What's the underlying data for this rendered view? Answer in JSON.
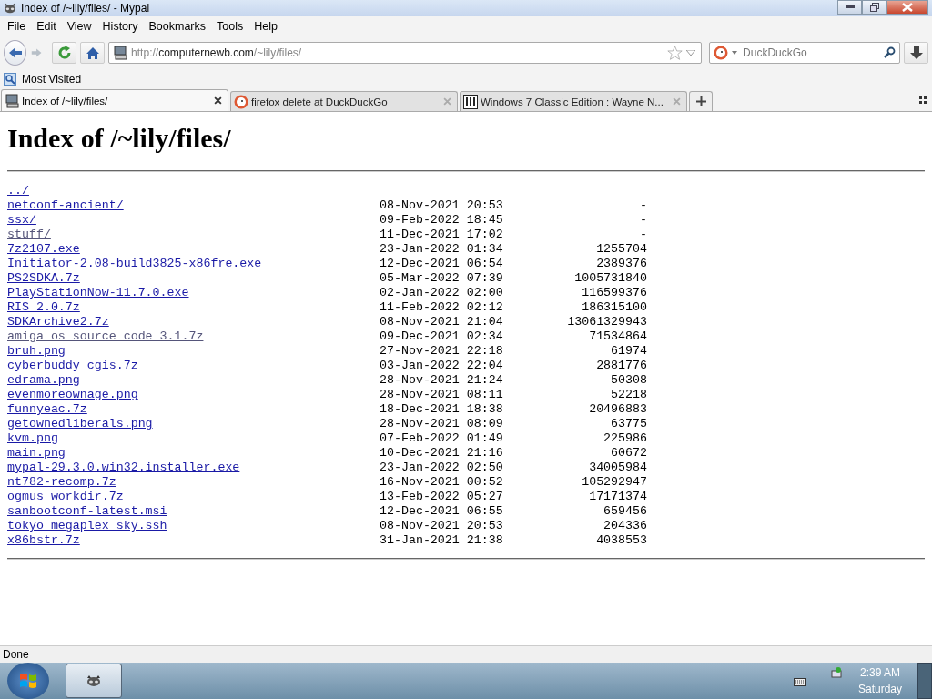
{
  "window": {
    "title": "Index of /~lily/files/ - Mypal"
  },
  "menu": [
    "File",
    "Edit",
    "View",
    "History",
    "Bookmarks",
    "Tools",
    "Help"
  ],
  "address_bar": {
    "scheme": "http://",
    "host": "computernewb.com",
    "path": "/~lily/files/"
  },
  "search": {
    "placeholder": "DuckDuckGo"
  },
  "bookmarks": [
    "Most Visited"
  ],
  "tabs": [
    {
      "label": "Index of /~lily/files/",
      "selected": true,
      "kind": "page"
    },
    {
      "label": "firefox delete at DuckDuckGo",
      "selected": false,
      "kind": "duck"
    },
    {
      "label": "Windows 7 Classic Edition : Wayne N...",
      "selected": false,
      "kind": "archive"
    }
  ],
  "page": {
    "heading": "Index of /~lily/files/",
    "rows": [
      {
        "name": "../",
        "date": "",
        "size": "",
        "visited": false
      },
      {
        "name": "netconf-ancient/",
        "date": "08-Nov-2021 20:53",
        "size": "-",
        "visited": false
      },
      {
        "name": "ssx/",
        "date": "09-Feb-2022 18:45",
        "size": "-",
        "visited": false
      },
      {
        "name": "stuff/",
        "date": "11-Dec-2021 17:02",
        "size": "-",
        "visited": true
      },
      {
        "name": "7z2107.exe",
        "date": "23-Jan-2022 01:34",
        "size": "1255704",
        "visited": false
      },
      {
        "name": "Initiator-2.08-build3825-x86fre.exe",
        "date": "12-Dec-2021 06:54",
        "size": "2389376",
        "visited": false
      },
      {
        "name": "PS2SDKA.7z",
        "date": "05-Mar-2022 07:39",
        "size": "1005731840",
        "visited": false
      },
      {
        "name": "PlayStationNow-11.7.0.exe",
        "date": "02-Jan-2022 02:00",
        "size": "116599376",
        "visited": false
      },
      {
        "name": "RIS 2.0.7z",
        "date": "11-Feb-2022 02:12",
        "size": "186315100",
        "visited": false
      },
      {
        "name": "SDKArchive2.7z",
        "date": "08-Nov-2021 21:04",
        "size": "13061329943",
        "visited": false
      },
      {
        "name": "amiga os source code 3.1.7z",
        "date": "09-Dec-2021 02:34",
        "size": "71534864",
        "visited": true
      },
      {
        "name": "bruh.png",
        "date": "27-Nov-2021 22:18",
        "size": "61974",
        "visited": false
      },
      {
        "name": "cyberbuddy cgis.7z",
        "date": "03-Jan-2022 22:04",
        "size": "2881776",
        "visited": false
      },
      {
        "name": "edrama.png",
        "date": "28-Nov-2021 21:24",
        "size": "50308",
        "visited": false
      },
      {
        "name": "evenmoreownage.png",
        "date": "28-Nov-2021 08:11",
        "size": "52218",
        "visited": false
      },
      {
        "name": "funnyeac.7z",
        "date": "18-Dec-2021 18:38",
        "size": "20496883",
        "visited": false
      },
      {
        "name": "getownedliberals.png",
        "date": "28-Nov-2021 08:09",
        "size": "63775",
        "visited": false
      },
      {
        "name": "kvm.png",
        "date": "07-Feb-2022 01:49",
        "size": "225986",
        "visited": false
      },
      {
        "name": "main.png",
        "date": "10-Dec-2021 21:16",
        "size": "60672",
        "visited": false
      },
      {
        "name": "mypal-29.3.0.win32.installer.exe",
        "date": "23-Jan-2022 02:50",
        "size": "34005984",
        "visited": false
      },
      {
        "name": "nt782-recomp.7z",
        "date": "16-Nov-2021 00:52",
        "size": "105292947",
        "visited": false
      },
      {
        "name": "ogmus workdir.7z",
        "date": "13-Feb-2022 05:27",
        "size": "17171374",
        "visited": false
      },
      {
        "name": "sanbootconf-latest.msi",
        "date": "12-Dec-2021 06:55",
        "size": "659456",
        "visited": false
      },
      {
        "name": "tokyo megaplex sky.ssh",
        "date": "08-Nov-2021 20:53",
        "size": "204336",
        "visited": false
      },
      {
        "name": "x86bstr.7z",
        "date": "31-Jan-2021 21:38",
        "size": "4038553",
        "visited": false
      }
    ]
  },
  "status_bar": "Done",
  "taskbar": {
    "time": "2:39 AM",
    "day": "Saturday"
  }
}
